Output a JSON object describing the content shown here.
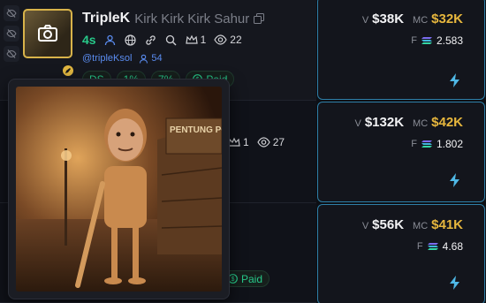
{
  "row1": {
    "ticker": "TripleK",
    "name": "Kirk Kirk Kirk Sahur",
    "age": "4s",
    "holders_stat": "1",
    "views_stat": "22",
    "handle": "@tripleKsol",
    "followers": "54",
    "paid_label": "Paid",
    "pills": [
      "DS",
      "1%",
      "7%"
    ]
  },
  "row2": {
    "holders_stat": "1",
    "views_stat": "27"
  },
  "row3": {
    "paid_label": "Paid"
  },
  "cards": [
    {
      "v_label": "V",
      "volume": "$38K",
      "mc_label": "MC",
      "market_cap": "$32K",
      "f_label": "F",
      "fee": "2.583"
    },
    {
      "v_label": "V",
      "volume": "$132K",
      "mc_label": "MC",
      "market_cap": "$42K",
      "f_label": "F",
      "fee": "1.802"
    },
    {
      "v_label": "V",
      "volume": "$56K",
      "mc_label": "MC",
      "market_cap": "$41K",
      "f_label": "F",
      "fee": "4.68"
    }
  ],
  "popover": {
    "sign_text": "PENTUNG POS RONI"
  },
  "colors": {
    "accent_green": "#27c98a",
    "market_cap_gold": "#e6b63d",
    "card_border": "#2e7fa8",
    "link_blue": "#5a8cf0"
  }
}
